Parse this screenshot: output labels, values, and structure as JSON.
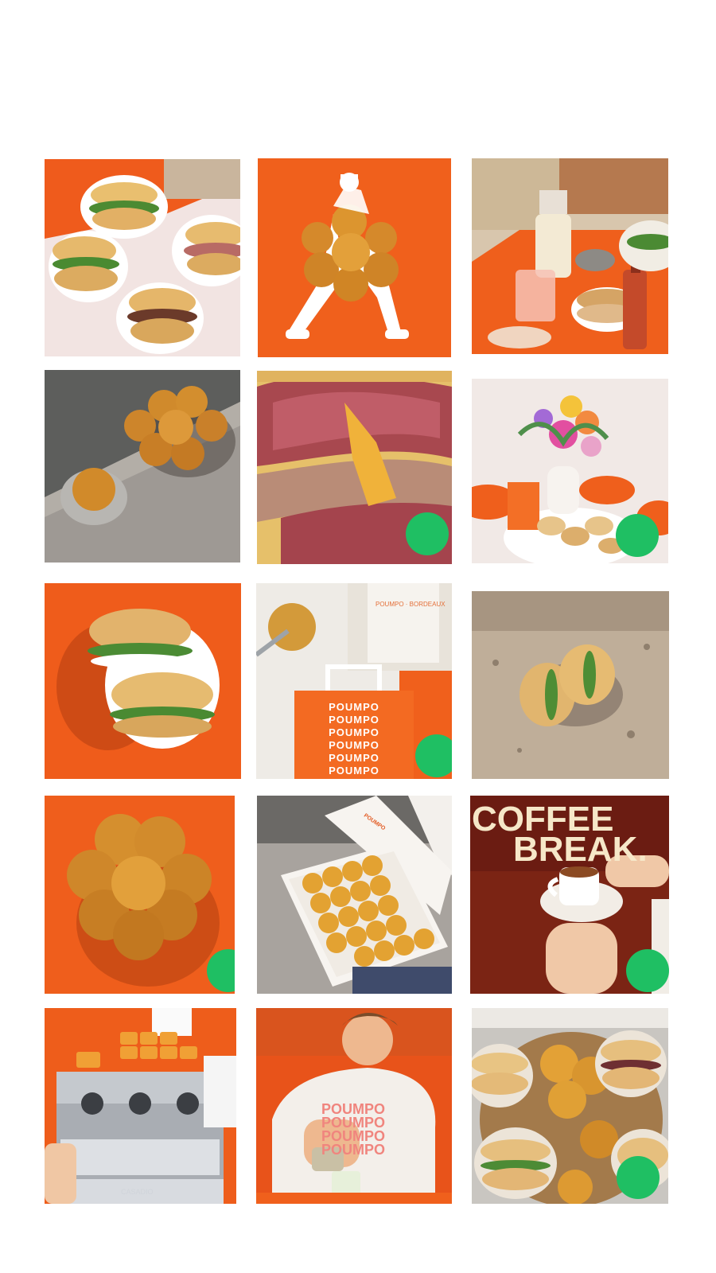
{
  "feed": {
    "tiles": [
      {
        "name": "sandwich-bowls-photo"
      },
      {
        "name": "bun-mascot-illustration"
      },
      {
        "name": "terrace-table-photo"
      },
      {
        "name": "flower-brioche-stone-photo"
      },
      {
        "name": "pastrami-closeup-photo",
        "badge": true
      },
      {
        "name": "flowers-table-photo",
        "badge": true
      },
      {
        "name": "sandwich-plate-orange-photo"
      },
      {
        "name": "poumpo-bag-photo",
        "badge": true
      },
      {
        "name": "sandwich-rock-photo"
      },
      {
        "name": "brioche-orange-photo",
        "badge": true
      },
      {
        "name": "brioche-box-photo"
      },
      {
        "name": "coffee-break-post",
        "badge": true
      },
      {
        "name": "espresso-machine-photo"
      },
      {
        "name": "barista-pouring-photo"
      },
      {
        "name": "sandwich-basket-photo",
        "badge": true
      }
    ],
    "badge_color": "#1fbf63"
  },
  "brand": {
    "bag_lines": [
      "POUMPO",
      "POUMPO",
      "POUMPO",
      "POUMPO",
      "POUMPO",
      "POUMPO"
    ],
    "shirt_lines": [
      "POUMPO",
      "POUMPO",
      "POUMPO",
      "POUMPO"
    ],
    "box_text": "POUMPO",
    "machine_brand": "CASADIO",
    "tee_tag": "POUMPO · BORDEAUX"
  },
  "coffee_post": {
    "line1": "COFFEE",
    "line2": "BREAK."
  },
  "colors": {
    "accent_orange": "#f0601c",
    "cream": "#f6e7c8",
    "maroon": "#6b1c12",
    "badge_green": "#1fbf63"
  }
}
